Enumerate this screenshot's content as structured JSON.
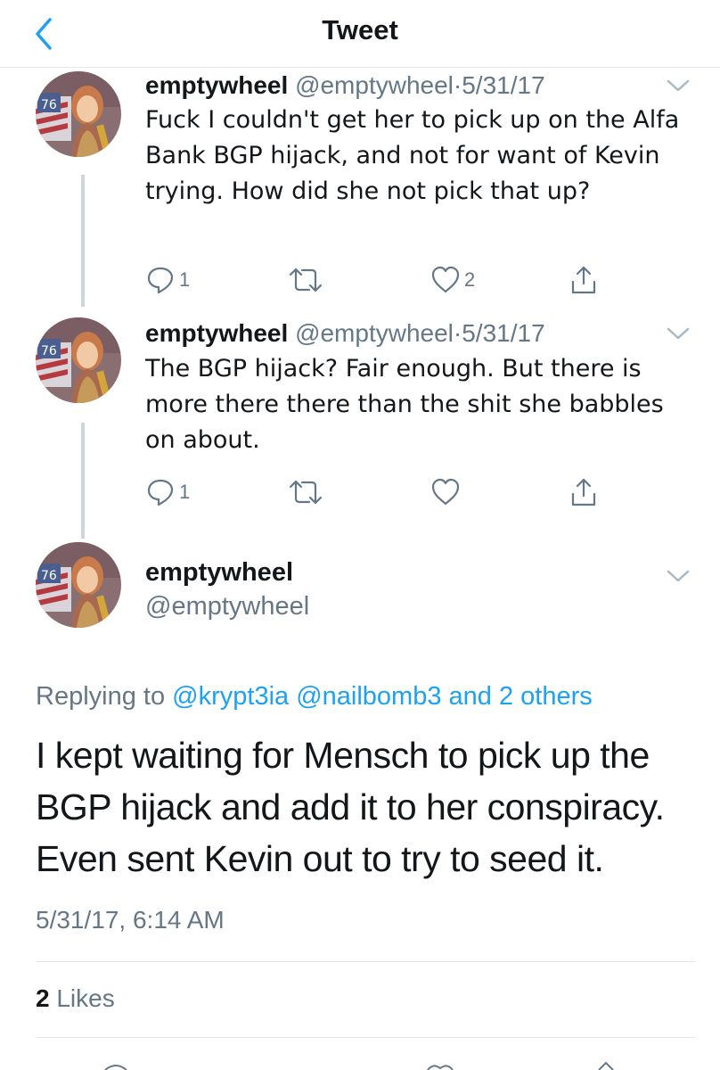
{
  "nav": {
    "title": "Tweet"
  },
  "colors": {
    "accent": "#1da1f2",
    "secondary_text": "#657786",
    "primary_text": "#14171a",
    "divider": "#e1e8ed"
  },
  "thread": [
    {
      "name": "emptywheel",
      "handle": "@emptywheel",
      "separator": "·",
      "date": "5/31/17",
      "text": "Fuck I couldn't get her to pick up on the Alfa Bank BGP hijack, and not for want of Kevin trying. How did she not pick that up?",
      "actions": {
        "reply_count": "1",
        "retweet_count": "",
        "like_count": "2"
      }
    },
    {
      "name": "emptywheel",
      "handle": "@emptywheel",
      "separator": "·",
      "date": "5/31/17",
      "text": "The BGP hijack? Fair enough. But there is more there there than the shit she babbles on about.",
      "actions": {
        "reply_count": "1",
        "retweet_count": "",
        "like_count": ""
      }
    }
  ],
  "main_tweet": {
    "name": "emptywheel",
    "handle": "@emptywheel",
    "replying_prefix": "Replying to",
    "replying_to": [
      "@krypt3ia",
      "@nailbomb3",
      "and 2 others"
    ],
    "text": "I kept waiting for Mensch to pick up the BGP hijack and add it to her conspiracy. Even sent Kevin out to try to seed it.",
    "timestamp": "5/31/17, 6:14 AM",
    "likes_count": "2",
    "likes_label": "Likes"
  },
  "icons": [
    "back-chevron-icon",
    "caret-down-icon",
    "reply-icon",
    "retweet-icon",
    "like-icon",
    "share-icon"
  ]
}
